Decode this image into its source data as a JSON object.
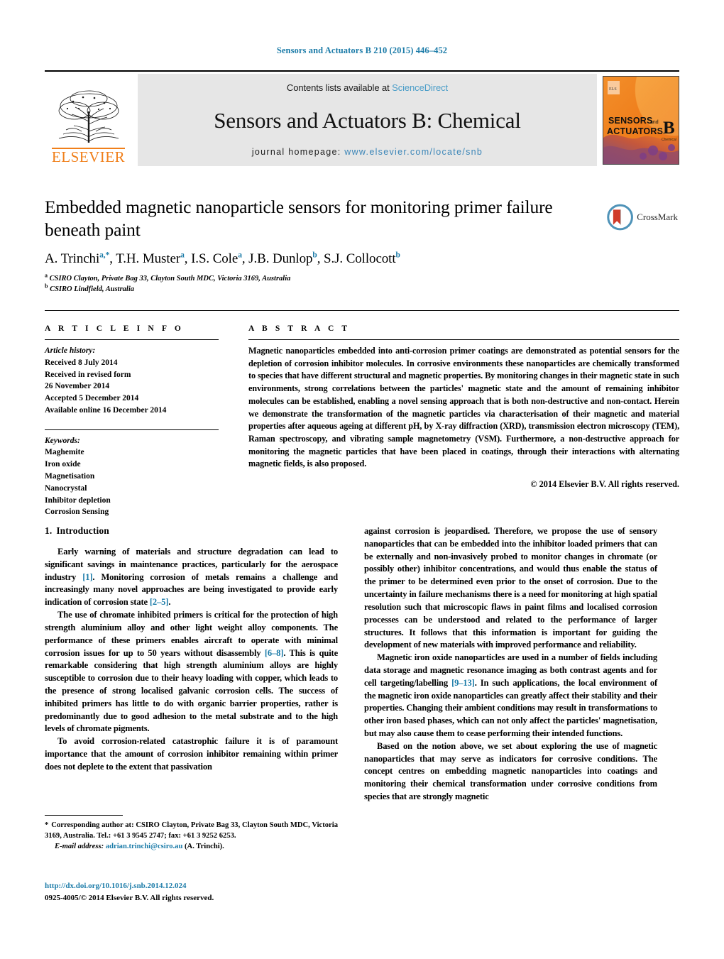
{
  "running_head": "Sensors and Actuators B 210 (2015) 446–452",
  "masthead": {
    "contents_prefix": "Contents lists available at ",
    "sciencedirect": "ScienceDirect",
    "journal_title": "Sensors and Actuators B: Chemical",
    "homepage_label": "journal homepage:",
    "homepage_url": "www.elsevier.com/locate/snb",
    "publisher_wordmark": "ELSEVIER",
    "cover": {
      "line1": "SENSORS",
      "and": "and",
      "line2": "ACTUATORS",
      "letter": "B",
      "sub": "Chemical"
    },
    "link_color": "#4a9dc8",
    "brand_color": "#F07F1A",
    "band_bg": "#e6e6e6"
  },
  "article": {
    "title": "Embedded magnetic nanoparticle sensors for monitoring primer failure beneath paint",
    "authors": [
      {
        "name": "A. Trinchi",
        "marks": "a,*"
      },
      {
        "name": "T.H. Muster",
        "marks": "a"
      },
      {
        "name": "I.S. Cole",
        "marks": "a"
      },
      {
        "name": "J.B. Dunlop",
        "marks": "b"
      },
      {
        "name": "S.J. Collocott",
        "marks": "b"
      }
    ],
    "affiliations": [
      {
        "mark": "a",
        "text": "CSIRO Clayton, Private Bag 33, Clayton South MDC, Victoria 3169, Australia"
      },
      {
        "mark": "b",
        "text": "CSIRO Lindfield, Australia"
      }
    ],
    "crossmark_label": "CrossMark"
  },
  "info": {
    "heading": "A R T I C L E   I N F O",
    "history_title": "Article history:",
    "history": [
      "Received 8 July 2014",
      "Received in revised form",
      "26 November 2014",
      "Accepted 5 December 2014",
      "Available online 16 December 2014"
    ],
    "keywords_title": "Keywords:",
    "keywords": [
      "Maghemite",
      "Iron oxide",
      "Magnetisation",
      "Nanocrystal",
      "Inhibitor depletion",
      "Corrosion Sensing"
    ]
  },
  "abstract": {
    "heading": "A B S T R A C T",
    "text": "Magnetic nanoparticles embedded into anti-corrosion primer coatings are demonstrated as potential sensors for the depletion of corrosion inhibitor molecules. In corrosive environments these nanoparticles are chemically transformed to species that have different structural and magnetic properties. By monitoring changes in their magnetic state in such environments, strong correlations between the particles' magnetic state and the amount of remaining inhibitor molecules can be established, enabling a novel sensing approach that is both non-destructive and non-contact. Herein we demonstrate the transformation of the magnetic particles via characterisation of their magnetic and material properties after aqueous ageing at different pH, by X-ray diffraction (XRD), transmission electron microscopy (TEM), Raman spectroscopy, and vibrating sample magnetometry (VSM). Furthermore, a non-destructive approach for monitoring the magnetic particles that have been placed in coatings, through their interactions with alternating magnetic fields, is also proposed.",
    "copyright": "© 2014 Elsevier B.V. All rights reserved."
  },
  "introduction": {
    "number": "1.",
    "heading": "Introduction",
    "left_paragraphs": [
      {
        "parts": [
          {
            "t": "Early warning of materials and structure degradation can lead to significant savings in maintenance practices, particularly for the aerospace industry "
          },
          {
            "t": "[1]",
            "ref": true
          },
          {
            "t": ". Monitoring corrosion of metals remains a challenge and increasingly many novel approaches are being investigated to provide early indication of corrosion state "
          },
          {
            "t": "[2–5]",
            "ref": true
          },
          {
            "t": "."
          }
        ]
      },
      {
        "parts": [
          {
            "t": "The use of chromate inhibited primers is critical for the protection of high strength aluminium alloy and other light weight alloy components. The performance of these primers enables aircraft to operate with minimal corrosion issues for up to 50 years without disassembly "
          },
          {
            "t": "[6–8]",
            "ref": true
          },
          {
            "t": ". This is quite remarkable considering that high strength aluminium alloys are highly susceptible to corrosion due to their heavy loading with copper, which leads to the presence of strong localised galvanic corrosion cells. The success of inhibited primers has little to do with organic barrier properties, rather is predominantly due to good adhesion to the metal substrate and to the high levels of chromate pigments."
          }
        ]
      },
      {
        "parts": [
          {
            "t": "To avoid corrosion-related catastrophic failure it is of paramount importance that the amount of corrosion inhibitor remaining within primer does not deplete to the extent that passivation"
          }
        ]
      }
    ],
    "right_paragraphs": [
      {
        "indent": false,
        "parts": [
          {
            "t": "against corrosion is jeopardised. Therefore, we propose the use of sensory nanoparticles that can be embedded into the inhibitor loaded primers that can be externally and non-invasively probed to monitor changes in chromate (or possibly other) inhibitor concentrations, and would thus enable the status of the primer to be determined even prior to the onset of corrosion. Due to the uncertainty in failure mechanisms there is a need for monitoring at high spatial resolution such that microscopic flaws in paint films and localised corrosion processes can be understood and related to the performance of larger structures. It follows that this information is important for guiding the development of new materials with improved performance and reliability."
          }
        ]
      },
      {
        "indent": true,
        "parts": [
          {
            "t": "Magnetic iron oxide nanoparticles are used in a number of fields including data storage and magnetic resonance imaging as both contrast agents and for cell targeting/labelling "
          },
          {
            "t": "[9–13]",
            "ref": true
          },
          {
            "t": ". In such applications, the local environment of the magnetic iron oxide nanoparticles can greatly affect their stability and their properties. Changing their ambient conditions may result in transformations to other iron based phases, which can not only affect the particles' magnetisation, but may also cause them to cease performing their intended functions."
          }
        ]
      },
      {
        "indent": true,
        "parts": [
          {
            "t": "Based on the notion above, we set about exploring the use of magnetic nanoparticles that may serve as indicators for corrosive conditions. The concept centres on embedding magnetic nanoparticles into coatings and monitoring their chemical transformation under corrosive conditions from species that are strongly magnetic"
          }
        ]
      }
    ]
  },
  "footnote": {
    "star": "*",
    "corresponding": "Corresponding author at: CSIRO Clayton, Private Bag 33, Clayton South MDC, Victoria 3169, Australia. Tel.: +61 3 9545 2747; fax: +61 3 9252 6253.",
    "email_label": "E-mail address:",
    "email": "adrian.trinchi@csiro.au",
    "email_owner": "(A. Trinchi).",
    "doi": "http://dx.doi.org/10.1016/j.snb.2014.12.024",
    "issn_line": "0925-4005/© 2014 Elsevier B.V. All rights reserved."
  }
}
